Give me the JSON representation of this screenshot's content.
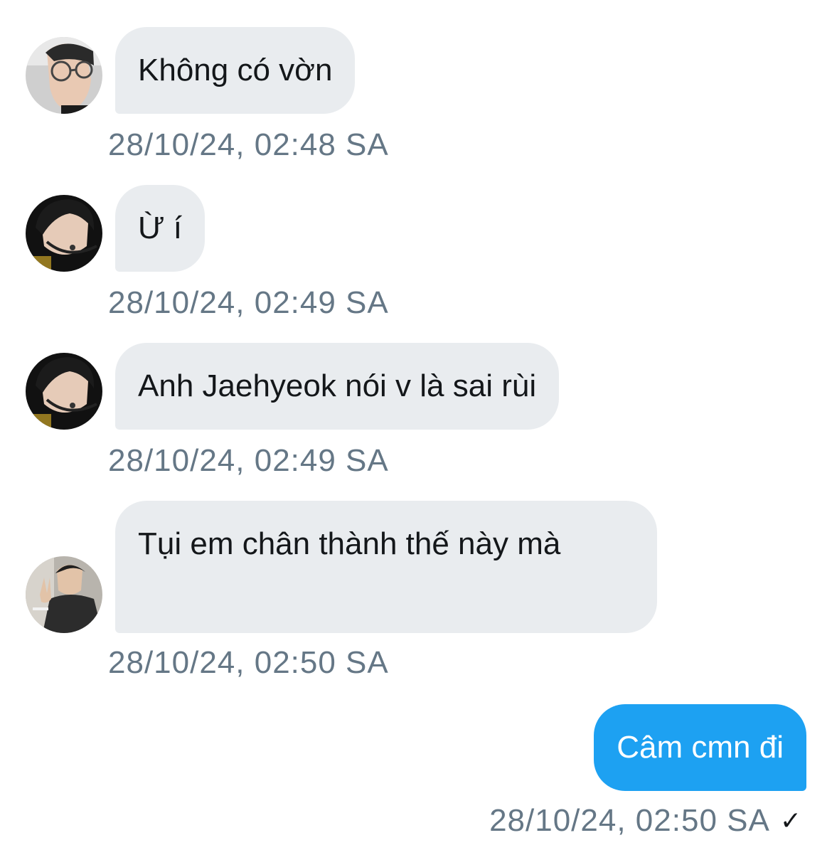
{
  "messages": [
    {
      "direction": "incoming",
      "avatar": "avatar-glasses-profile",
      "text": "Không có vờn",
      "timestamp": "28/10/24, 02:48 SA"
    },
    {
      "direction": "incoming",
      "avatar": "avatar-headset-dark",
      "text": "Ừ í",
      "timestamp": "28/10/24, 02:49 SA"
    },
    {
      "direction": "incoming",
      "avatar": "avatar-headset-dark",
      "text": "Anh Jaehyeok nói v là sai rùi",
      "timestamp": "28/10/24, 02:49 SA"
    },
    {
      "direction": "incoming",
      "avatar": "avatar-peace-sign",
      "text": "Tụi em chân thành thế này mà",
      "timestamp": "28/10/24, 02:50 SA"
    },
    {
      "direction": "outgoing",
      "text": "Câm cmn đi",
      "timestamp": "28/10/24, 02:50 SA",
      "status_icon": "checkmark-icon"
    }
  ],
  "colors": {
    "incoming_bubble": "#e9ecef",
    "outgoing_bubble": "#1da1f2",
    "timestamp": "#657786"
  }
}
